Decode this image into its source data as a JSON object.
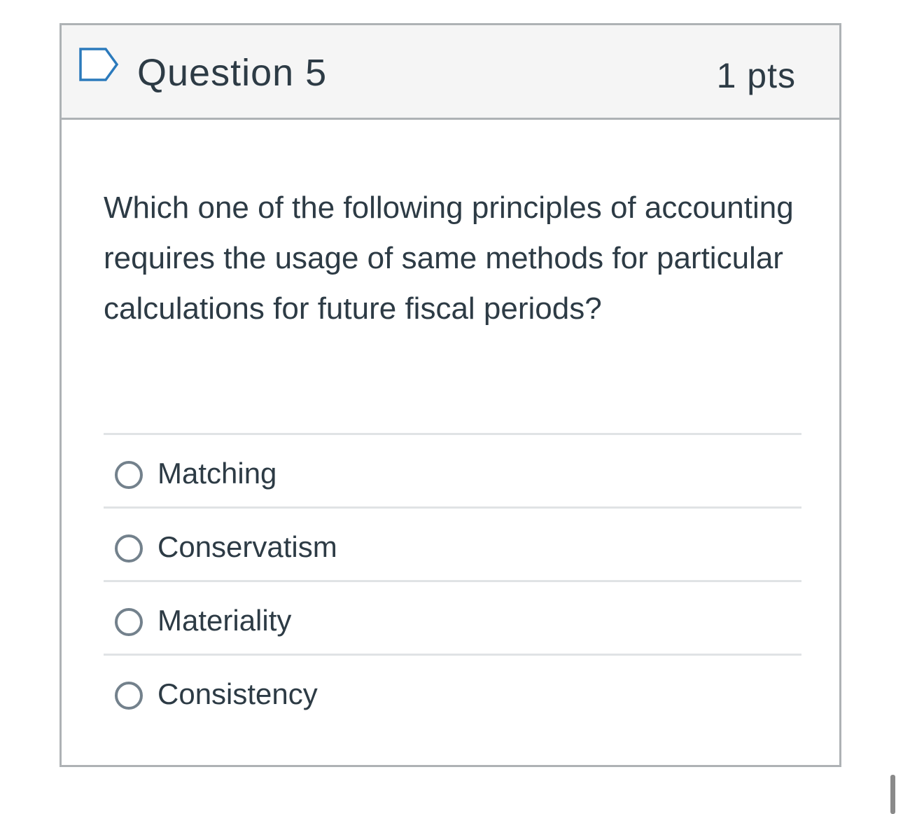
{
  "question": {
    "title": "Question 5",
    "points": "1 pts",
    "flag_icon": "flag-outline-icon",
    "text": "Which one of the following principles of accounting requires the usage of same methods for particular calculations for future fiscal periods?"
  },
  "answers": [
    {
      "label": "Matching",
      "selected": false
    },
    {
      "label": "Conservatism",
      "selected": false
    },
    {
      "label": "Materiality",
      "selected": false
    },
    {
      "label": "Consistency",
      "selected": false
    }
  ],
  "colors": {
    "text": "#2d3b45",
    "border": "#aeb2b5",
    "header_bg": "#f5f5f5",
    "flag": "#2b7abc",
    "radio": "#73818c",
    "divider": "#e0e3e5"
  }
}
